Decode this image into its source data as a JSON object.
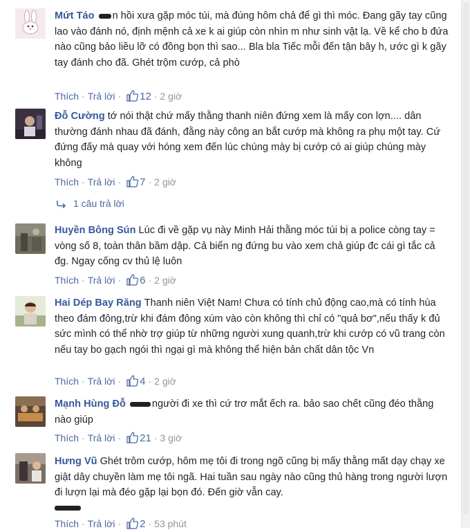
{
  "actions": {
    "like": "Thích",
    "reply": "Trả lời"
  },
  "comments": [
    {
      "author": "Mứt Táo",
      "text": "n hồi xưa gặp móc túi, mà đúng hôm chả để gì thì móc. Đang gãy tay cũng lao vào đánh nó, định mệnh cả xe k ai giúp còn nhìn m như sinh vật lạ. Về kể cho b đứa nào cũng bảo liều lỡ có đồng bọn thì sao... Bla bla Tiếc mỗi đến tận bây h, ước gì k gãy tay đánh cho đã. Ghét trộm cướp, cả phò",
      "likes": "12",
      "time": "2 giờ"
    },
    {
      "author": "Đỗ Cường",
      "text": "tớ nói thật chứ mấy thằng thanh niên đứng xem là mấy con lợn.... dân thường đánh nhau đã đánh, đằng này công an bắt cướp mà không ra phụ một tay. Cứ đứng đấy mà quay với hóng xem đến lúc chúng mày bị cướp có ai giúp chúng mày không",
      "likes": "7",
      "time": "2 giờ"
    },
    {
      "author": "Huyền Bông Sún",
      "text": "Lúc đi về gặp vụ này Minh Hải thằng móc túi bị a police còng tay = vòng số 8, toàn thân bầm dập. Cả biển ng đứng bu vào xem chả giúp đc cái gì tắc cả đg. Ngay cống cv thủ lệ luôn",
      "likes": "6",
      "time": "2 giờ"
    },
    {
      "author": "Hai Dép Bay Răng",
      "text": "Thanh niên Việt Nam! Chưa có tính chủ động cao,mà có tính hùa theo đám đông,trừ khi đám đông xúm vào còn không thì chỉ có \"quả bơ\",nếu thấy k đủ sức mình có thể nhờ trợ giúp từ những người xung quanh,trừ khi cướp có vũ trang còn nếu tay bo gạch ngói thì ngại gì mà không thể hiện bản chất dân tộc Vn",
      "likes": "4",
      "time": "2 giờ"
    },
    {
      "author": "Mạnh Hùng Đỗ",
      "text": "người đi xe thì cứ trơ mắt ếch ra. bảo sao chết cũng đéo thằng nào giúp",
      "likes": "21",
      "time": "3 giờ"
    },
    {
      "author": "Hưng Vũ",
      "text": "Ghét trôm cướp, hôm mẹ tôi đi trong ngõ cũng bị mấy thằng mất dạy chạy xe giật dây chuyền làm mẹ tôi ngã. Hai tuần sau ngày nào cũng thủ hàng trong người lượn đi lượn lại mà đéo gặp lại bọn đó. Đến giờ vẫn cay.",
      "likes": "2",
      "time": "53 phút"
    }
  ],
  "replies_link": "1 câu trả lời",
  "colors": {
    "name": "#365899",
    "link": "#4b67a1",
    "meta": "#90949c",
    "text": "#1d2129"
  }
}
